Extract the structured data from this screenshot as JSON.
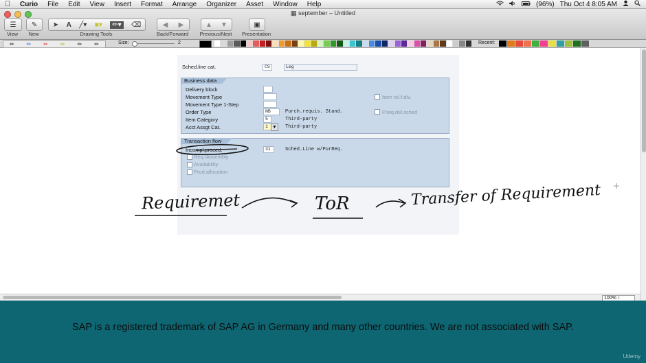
{
  "menubar": {
    "app": "Curio",
    "items": [
      "File",
      "Edit",
      "View",
      "Insert",
      "Format",
      "Arrange",
      "Organizer",
      "Asset",
      "Window",
      "Help"
    ],
    "battery": "(96%)",
    "clock": "Thu Oct 4  8:05 AM"
  },
  "window": {
    "title": "september – Untitled",
    "toolbar": {
      "view_label": "View",
      "new_label": "New",
      "drawing_tools_label": "Drawing Tools",
      "back_forward_label": "Back/Forward",
      "prev_next_label": "Previous/Next",
      "presentation_label": "Presentation"
    },
    "drawbar": {
      "size_label": "Size:",
      "size_value": "2",
      "recent_label": "Recent:"
    },
    "zoom": "100%"
  },
  "sap": {
    "sched_line_cat_label": "Sched.line cat.",
    "sched_line_cat_value": "CS",
    "sched_line_cat_desc": "Leg",
    "business_data": {
      "title": "Business data",
      "delivery_block_label": "Delivery block",
      "movement_type_label": "Movement Type",
      "movement_type_1step_label": "Movement Type 1-Step",
      "order_type_label": "Order Type",
      "order_type_value": "NB",
      "order_type_desc": "Purch.requis. Stand.",
      "item_category_label": "Item Category",
      "item_category_value": "5",
      "item_category_desc": "Third-party",
      "acct_assgt_label": "Acct Assgt Cat.",
      "acct_assgt_value": "1",
      "acct_assgt_desc": "Third-party",
      "item_rel_dlv_label": "Item rel.f.dlv.",
      "preq_del_sched_label": "P.req.del.sched"
    },
    "transaction_flow": {
      "title": "Transaction flow",
      "incompl_label": "Incompl.proced.",
      "incompl_value": "31",
      "incompl_desc": "Sched.Line w/PurReq.",
      "req_assembly_label": "Req./Assembly",
      "availability_label": "Availability",
      "prod_allocation_label": "Prod.allocation"
    }
  },
  "handwriting": {
    "word1": "Requiremet",
    "word2": "ToR",
    "word3": "Transfer  of  Requirement"
  },
  "footer": {
    "text": "SAP is a registered trademark of SAP AG in Germany and many other countries. We are not associated with SAP.",
    "brand": "Udemy"
  },
  "colors": {
    "footer_bg": "#0e6672",
    "sap_group_bg": "#c9d9ea",
    "sap_group_title": "#a9c0da"
  }
}
